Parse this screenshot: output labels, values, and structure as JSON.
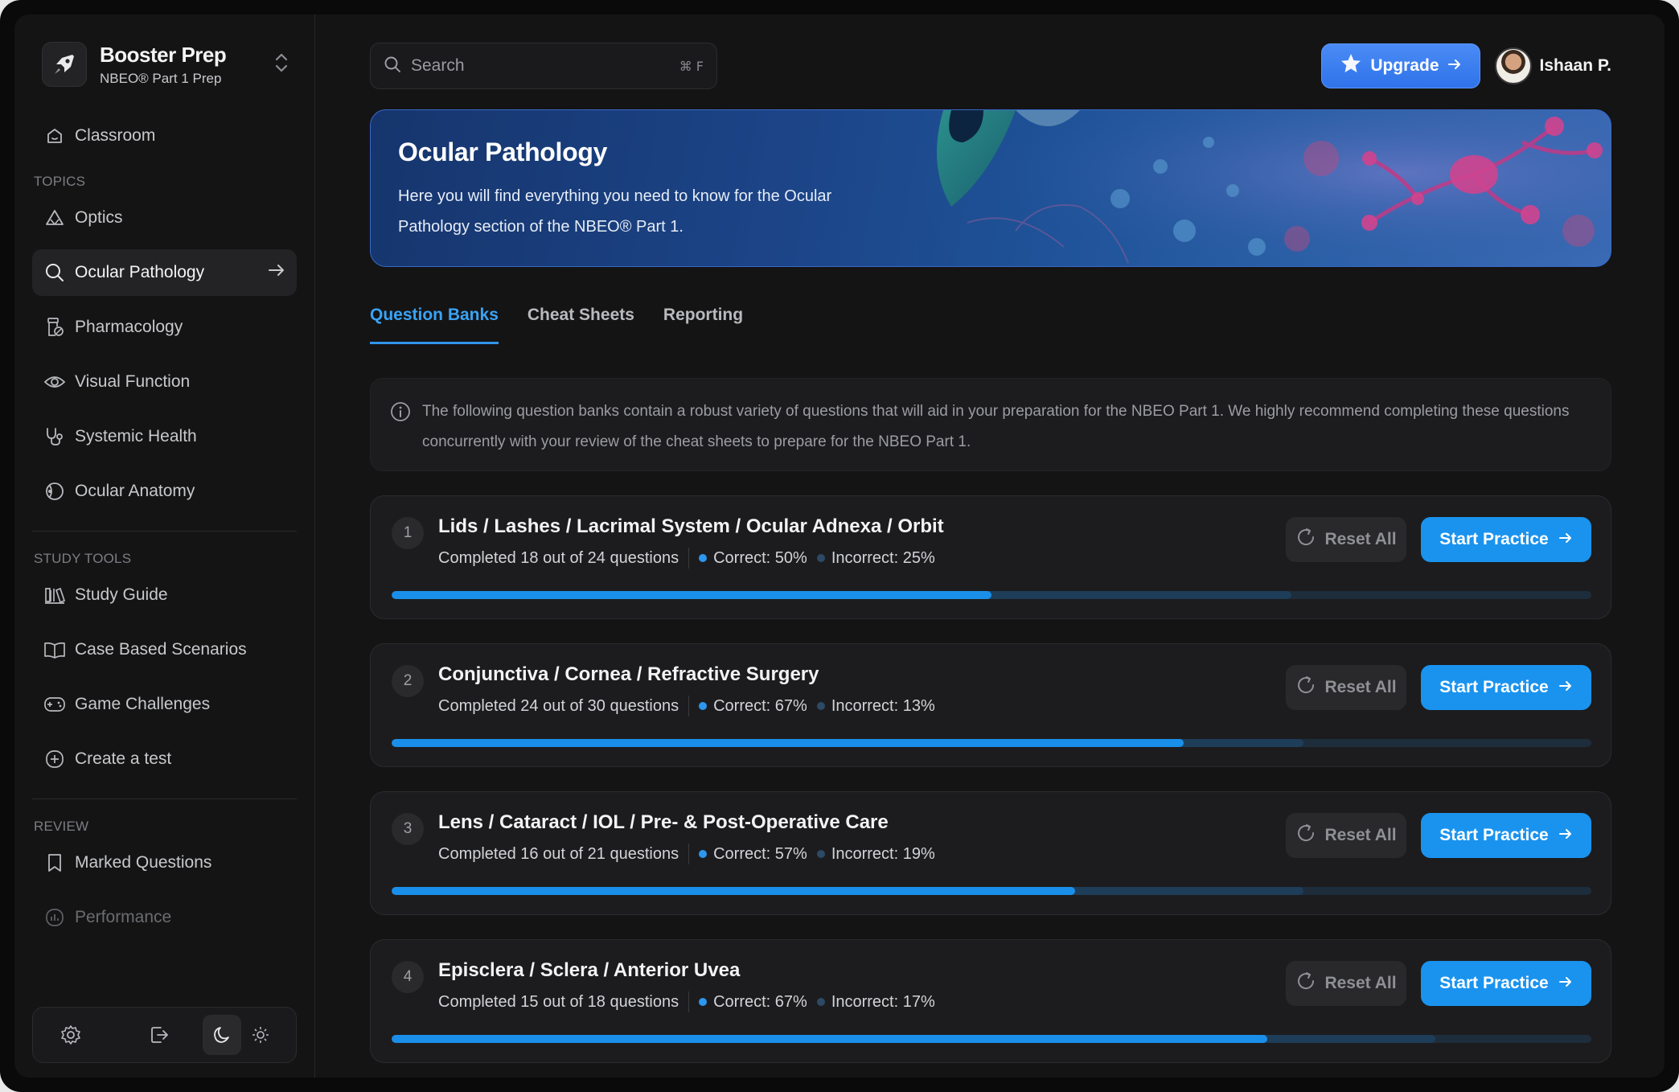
{
  "app": {
    "name": "Booster Prep",
    "subtitle": "NBEO® Part 1 Prep"
  },
  "sidebar": {
    "classroom_label": "Classroom",
    "topics_label": "TOPICS",
    "topics": [
      {
        "label": "Optics",
        "icon": "triangle-ruler-icon"
      },
      {
        "label": "Ocular Pathology",
        "icon": "search-icon",
        "active": true
      },
      {
        "label": "Pharmacology",
        "icon": "pill-bottle-icon"
      },
      {
        "label": "Visual Function",
        "icon": "eye-icon"
      },
      {
        "label": "Systemic Health",
        "icon": "stethoscope-icon"
      },
      {
        "label": "Ocular Anatomy",
        "icon": "eye-anatomy-icon"
      }
    ],
    "study_tools_label": "STUDY TOOLS",
    "study_tools": [
      {
        "label": "Study Guide",
        "icon": "books-icon"
      },
      {
        "label": "Case Based Scenarios",
        "icon": "open-book-icon"
      },
      {
        "label": "Game Challenges",
        "icon": "gamepad-icon"
      },
      {
        "label": "Create a test",
        "icon": "plus-circle-icon"
      }
    ],
    "review_label": "REVIEW",
    "review": [
      {
        "label": "Marked Questions",
        "icon": "bookmark-icon"
      },
      {
        "label": "Performance",
        "icon": "bar-chart-icon"
      }
    ]
  },
  "topbar": {
    "search_placeholder": "Search",
    "search_shortcut": "⌘ F",
    "upgrade_label": "Upgrade",
    "user_name": "Ishaan P."
  },
  "hero": {
    "title": "Ocular Pathology",
    "description": "Here you will find everything you need to know for the Ocular Pathology section of the NBEO® Part 1."
  },
  "tabs": [
    "Question Banks",
    "Cheat Sheets",
    "Reporting"
  ],
  "active_tab": "Question Banks",
  "info_text": "The following question banks contain a robust variety of questions that will aid in your preparation for the NBEO Part 1. We highly recommend completing these questions concurrently with your review of the cheat sheets to prepare for the NBEO Part 1.",
  "reset_label": "Reset All",
  "start_label": "Start Practice",
  "banks": [
    {
      "num": "1",
      "title": "Lids / Lashes / Lacrimal System / Ocular Adnexa / Orbit",
      "completed": "Completed 18 out of 24 questions",
      "correct": "Correct: 50%",
      "incorrect": "Incorrect: 25%",
      "correct_frac": 0.5,
      "answered_frac": 0.75
    },
    {
      "num": "2",
      "title": "Conjunctiva / Cornea / Refractive Surgery",
      "completed": "Completed 24 out of 30 questions",
      "correct": "Correct: 67%",
      "incorrect": "Incorrect: 13%",
      "correct_frac": 0.66,
      "answered_frac": 0.76
    },
    {
      "num": "3",
      "title": "Lens / Cataract / IOL / Pre- & Post-Operative Care",
      "completed": "Completed 16 out of 21 questions",
      "correct": "Correct: 57%",
      "incorrect": "Incorrect: 19%",
      "correct_frac": 0.57,
      "answered_frac": 0.76
    },
    {
      "num": "4",
      "title": "Episclera / Sclera / Anterior Uvea",
      "completed": "Completed 15 out of 18 questions",
      "correct": "Correct: 67%",
      "incorrect": "Incorrect: 17%",
      "correct_frac": 0.73,
      "answered_frac": 0.87
    }
  ],
  "colors": {
    "accent": "#1a93ef",
    "upgrade": "#3a7ff0",
    "background": "#141415",
    "card": "#1c1c1e"
  }
}
